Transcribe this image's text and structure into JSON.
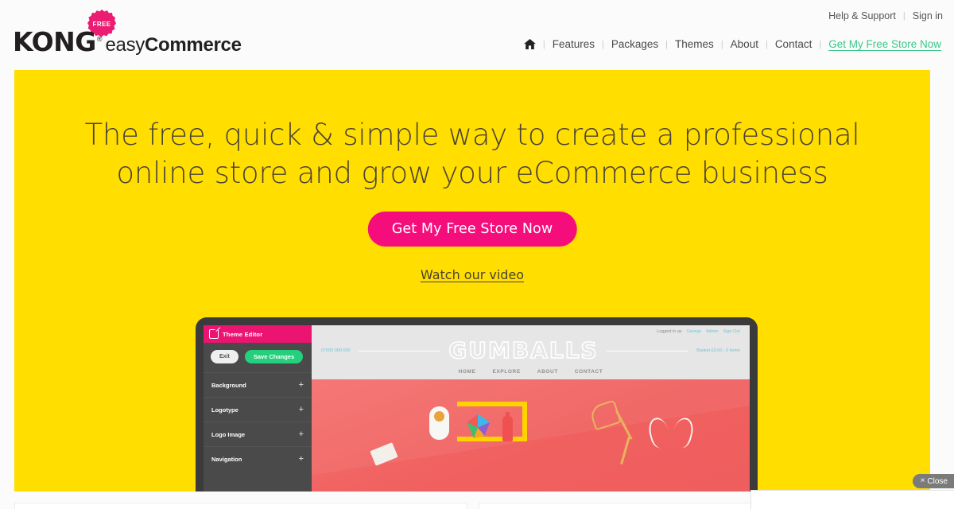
{
  "header": {
    "logo": {
      "badge_text": "FREE",
      "kong": "KONG",
      "trademark": "®",
      "easy": "easy",
      "commerce": "Commerce"
    },
    "utility_nav": [
      {
        "label": "Help & Support"
      },
      {
        "label": "Sign in"
      }
    ],
    "separator": "|",
    "main_nav": [
      {
        "label": "Features"
      },
      {
        "label": "Packages"
      },
      {
        "label": "Themes"
      },
      {
        "label": "About"
      },
      {
        "label": "Contact"
      },
      {
        "label": "Get My Free Store Now"
      }
    ],
    "home_icon": "home-icon"
  },
  "hero": {
    "background_color": "#ffde00",
    "title": "The free, quick & simple way to create a professional online store and grow your eCommerce business",
    "cta_label": "Get My Free Store Now",
    "cta_color": "#f50d7c",
    "video_link": "Watch our video"
  },
  "mockup": {
    "editor": {
      "title": "Theme Editor",
      "title_bar_color": "#ec1471",
      "exit_label": "Exit",
      "save_label": "Save Changes",
      "save_color": "#25d07d",
      "rows": [
        {
          "label": "Background",
          "control": "+"
        },
        {
          "label": "Logotype",
          "control": "+"
        },
        {
          "label": "Logo Image",
          "control": "+"
        },
        {
          "label": "Navigation",
          "control": "+"
        }
      ]
    },
    "store": {
      "logged_in_text": "Logged in as",
      "user_name": "George",
      "admin_link": "Admin",
      "signout_link": "Sign Out",
      "phone": "07000 000 000",
      "brand": "GUMBALLS",
      "basket": "Basket £0.00 - 0 items",
      "nav": [
        {
          "label": "HOME"
        },
        {
          "label": "EXPLORE"
        },
        {
          "label": "ABOUT"
        },
        {
          "label": "CONTACT"
        }
      ],
      "hero_color": "#f0605f"
    }
  },
  "overlay": {
    "close_label": "Close",
    "close_icon": "×"
  }
}
